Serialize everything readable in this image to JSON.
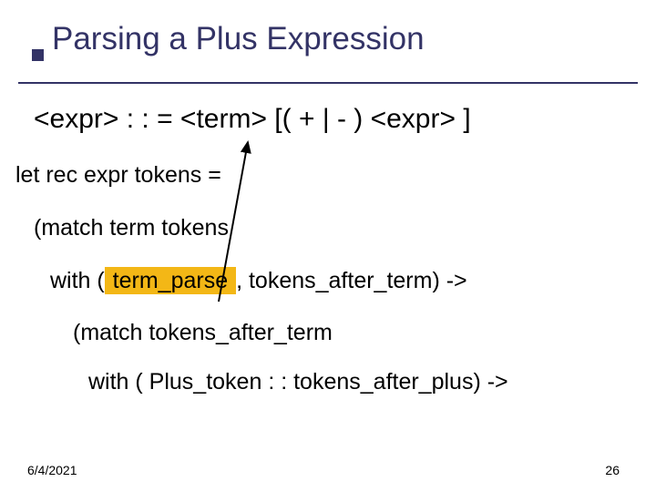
{
  "title": "Parsing a Plus Expression",
  "grammar": "<expr> : : = <term> [( + | - ) <expr> ]",
  "code": {
    "line1": "let rec expr tokens =",
    "line2": "(match term tokens",
    "line3a": "with (",
    "line3_hl": " term_parse ",
    "line3b": ", tokens_after_term) ->",
    "line4": "(match tokens_after_term",
    "line5": "with ( Plus_token  : : tokens_after_plus) ->"
  },
  "footer": {
    "date": "6/4/2021",
    "page": "26"
  }
}
